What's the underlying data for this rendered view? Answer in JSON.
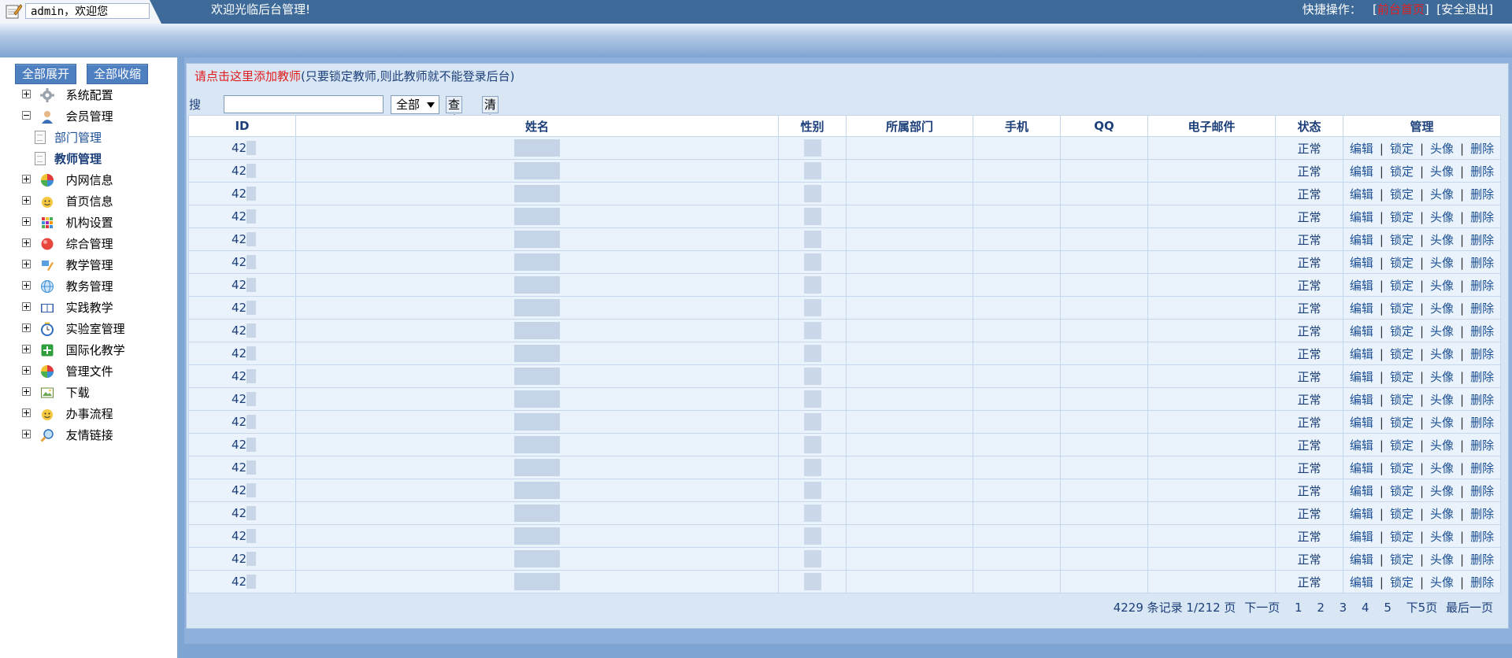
{
  "header": {
    "user_label": "admin，欢迎您",
    "welcome": "欢迎光临后台管理!",
    "quick_label": "快捷操作：",
    "quick_home": "前台首页",
    "quick_logout": "安全退出"
  },
  "sidebar": {
    "expand_all": "全部展开",
    "collapse_all": "全部收缩",
    "items": [
      {
        "label": "系统配置",
        "icon": "gear-icon",
        "expanded": false
      },
      {
        "label": "会员管理",
        "icon": "user-icon",
        "expanded": true,
        "children": [
          {
            "label": "部门管理",
            "current": false
          },
          {
            "label": "教师管理",
            "current": true
          }
        ]
      },
      {
        "label": "内网信息",
        "icon": "color-wheel-icon",
        "expanded": false
      },
      {
        "label": "首页信息",
        "icon": "smiley-icon",
        "expanded": false
      },
      {
        "label": "机构设置",
        "icon": "grid-icon",
        "expanded": false
      },
      {
        "label": "综合管理",
        "icon": "red-ball-icon",
        "expanded": false
      },
      {
        "label": "教学管理",
        "icon": "tools-icon",
        "expanded": false
      },
      {
        "label": "教务管理",
        "icon": "globe-icon",
        "expanded": false
      },
      {
        "label": "实践教学",
        "icon": "book-icon",
        "expanded": false
      },
      {
        "label": "实验室管理",
        "icon": "clock-icon",
        "expanded": false
      },
      {
        "label": "国际化教学",
        "icon": "green-plus-icon",
        "expanded": false
      },
      {
        "label": "管理文件",
        "icon": "color-wheel-icon",
        "expanded": false
      },
      {
        "label": "下载",
        "icon": "picture-icon",
        "expanded": false
      },
      {
        "label": "办事流程",
        "icon": "smiley-icon",
        "expanded": false
      },
      {
        "label": "友情链接",
        "icon": "search-icon",
        "expanded": false
      }
    ]
  },
  "main": {
    "add_link": "请点击这里添加教师",
    "add_note": "(只要锁定教师,则此教师就不能登录后台)",
    "search_label": "搜索：",
    "search_value": "",
    "search_select": "全部",
    "query_btn": "查询",
    "clear_btn": "清空"
  },
  "table": {
    "headers": [
      "ID",
      "姓名",
      "性别",
      "所属部门",
      "手机",
      "QQ",
      "电子邮件",
      "状态",
      "管理"
    ],
    "row_count": 20,
    "id_prefix": "42",
    "status": "正常",
    "actions": [
      "编辑",
      "锁定",
      "头像",
      "删除"
    ],
    "action_sep": "|"
  },
  "pager": {
    "summary": "4229 条记录 1/212 页",
    "next": "下一页",
    "pages": [
      "1",
      "2",
      "3",
      "4",
      "5"
    ],
    "next5": "下5页",
    "last": "最后一页"
  },
  "colors": {
    "topbar": "#3d6a99",
    "link_red": "#e01c1c",
    "text_blue": "#1c3f7a",
    "row_bg": "#eaf3fb"
  }
}
